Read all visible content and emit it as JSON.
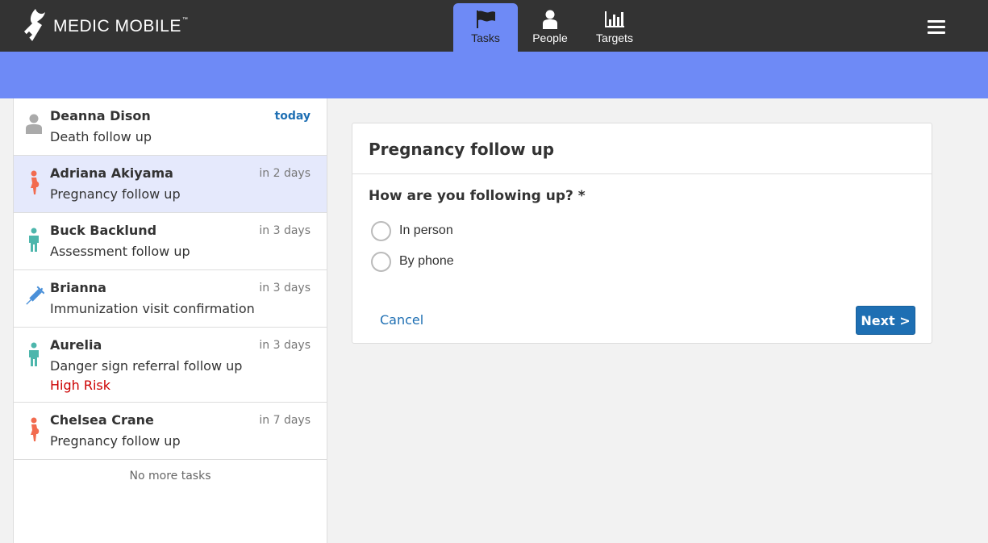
{
  "header": {
    "logo_text": "MEDIC MOBILE",
    "logo_tm": "™",
    "tabs": [
      {
        "label": "Tasks",
        "icon": "flag-icon",
        "active": true
      },
      {
        "label": "People",
        "icon": "person-icon",
        "active": false
      },
      {
        "label": "Targets",
        "icon": "bar-chart-icon",
        "active": false
      }
    ],
    "menu_icon": "hamburger-icon"
  },
  "colors": {
    "header_bg": "#333333",
    "accent": "#6e8af6",
    "link": "#1e6fb3",
    "warning": "#cc0000",
    "selected_row": "#e5e9fc"
  },
  "tasks": [
    {
      "name": "Deanna Dison",
      "description": "Death follow up",
      "due": "today",
      "icon": "person-grey-icon"
    },
    {
      "name": "Adriana Akiyama",
      "description": "Pregnancy follow up",
      "due": "in 2 days",
      "icon": "pregnant-woman-icon",
      "selected": true
    },
    {
      "name": "Buck Backlund",
      "description": "Assessment follow up",
      "due": "in 3 days",
      "icon": "child-icon"
    },
    {
      "name": "Brianna",
      "description": "Immunization visit confirmation",
      "due": "in 3 days",
      "icon": "syringe-icon"
    },
    {
      "name": "Aurelia",
      "description": "Danger sign referral follow up",
      "due": "in 3 days",
      "icon": "child-icon",
      "warning": "High Risk"
    },
    {
      "name": "Chelsea Crane",
      "description": "Pregnancy follow up",
      "due": "in 7 days",
      "icon": "pregnant-woman-icon"
    }
  ],
  "no_more_tasks": "No more tasks",
  "form": {
    "title": "Pregnancy follow up",
    "question": "How are you following up? *",
    "options": [
      "In person",
      "By phone"
    ],
    "cancel_label": "Cancel",
    "next_label": "Next >"
  }
}
